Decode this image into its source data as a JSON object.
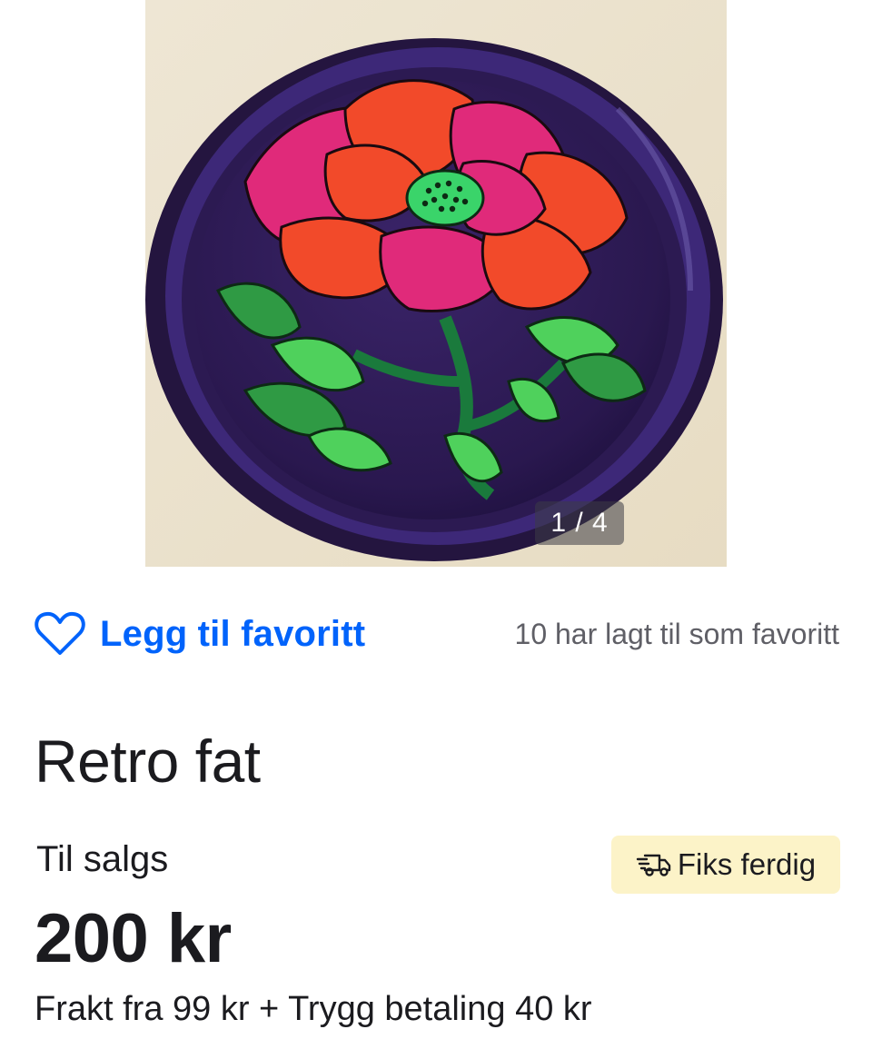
{
  "gallery": {
    "counter": "1 / 4"
  },
  "favorite": {
    "button_label": "Legg til favoritt",
    "count_text": "10 har lagt til som favoritt",
    "icon": "heart-outline-icon"
  },
  "listing": {
    "title": "Retro fat",
    "status": "Til salgs",
    "badge": {
      "icon": "truck-icon",
      "label": "Fiks ferdig"
    },
    "price": "200 kr",
    "shipping": "Frakt fra 99 kr + Trygg betaling 40 kr"
  },
  "colors": {
    "accent": "#0063fb",
    "badge_bg": "#fcf3c8",
    "text": "#1b1b1f",
    "muted": "#5f5f66"
  }
}
